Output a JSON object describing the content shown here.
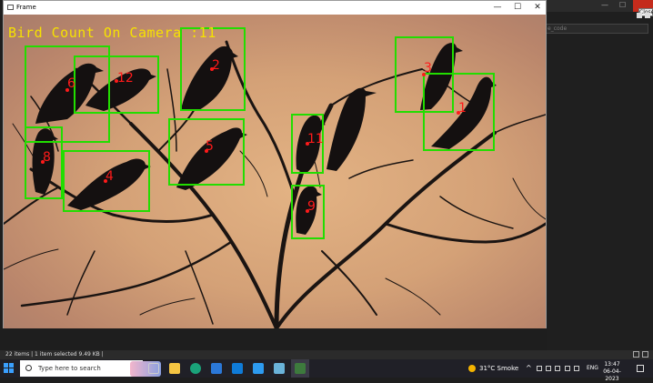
{
  "frame_window": {
    "title": "Frame",
    "overlay_text": "Bird Count On Camera  :11",
    "minimize": "—",
    "maximize": "☐",
    "close": "✕",
    "box_color": "#22dd00",
    "label_color": "#ff1a1a",
    "detections": [
      {
        "id": "6"
      },
      {
        "id": "12"
      },
      {
        "id": "2"
      },
      {
        "id": "3"
      },
      {
        "id": "1"
      },
      {
        "id": "8"
      },
      {
        "id": "4"
      },
      {
        "id": "5"
      },
      {
        "id": "11"
      },
      {
        "id": "9"
      }
    ]
  },
  "background_editor": {
    "search_placeholder": "e_code",
    "close_tooltip": "Close"
  },
  "explorer_status": {
    "text": "22 items  |  1 item selected  9.49 KB  |"
  },
  "taskbar": {
    "search_placeholder": "Type here to search",
    "weather": "31°C  Smoke",
    "language": "ENG",
    "time": "13:47",
    "date": "06-04-2023"
  }
}
